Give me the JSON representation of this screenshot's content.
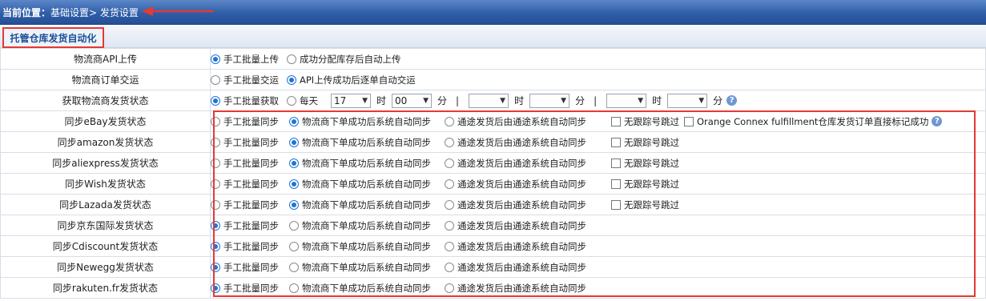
{
  "breadcrumb": {
    "label": "当前位置：",
    "path": "基础设置> 发货设置"
  },
  "section_title": "托管仓库发货自动化",
  "rows": [
    {
      "label": "物流商API上传",
      "options": [
        {
          "text": "手工批量上传",
          "checked": true
        },
        {
          "text": "成功分配库存后自动上传",
          "checked": false
        }
      ]
    },
    {
      "label": "物流商订单交运",
      "options": [
        {
          "text": "手工批量交运",
          "checked": false
        },
        {
          "text": "API上传成功后逐单自动交运",
          "checked": true
        }
      ]
    }
  ],
  "fetch_row": {
    "label": "获取物流商发货状态",
    "manual": "手工批量获取",
    "daily": "每天",
    "hour_value": "17",
    "min_value": "00",
    "hour_unit": "时",
    "min_unit": "分",
    "sep": "|"
  },
  "sync_options": [
    "手工批量同步",
    "物流商下单成功后系统自动同步",
    "通途发货后由通途系统自动同步"
  ],
  "skip_label": "无跟踪号跳过",
  "oc_label": "Orange Connex fulfillment仓库发货订单直接标记成功",
  "sync_rows": [
    {
      "label": "同步eBay发货状态",
      "selected": 1,
      "skip": true,
      "oc": true
    },
    {
      "label": "同步amazon发货状态",
      "selected": 1,
      "skip": true,
      "oc": false
    },
    {
      "label": "同步aliexpress发货状态",
      "selected": 1,
      "skip": true,
      "oc": false
    },
    {
      "label": "同步Wish发货状态",
      "selected": 1,
      "skip": true,
      "oc": false
    },
    {
      "label": "同步Lazada发货状态",
      "selected": 1,
      "skip": true,
      "oc": false
    },
    {
      "label": "同步京东国际发货状态",
      "selected": 0,
      "skip": false,
      "oc": false
    },
    {
      "label": "同步Cdiscount发货状态",
      "selected": 0,
      "skip": false,
      "oc": false
    },
    {
      "label": "同步Newegg发货状态",
      "selected": 0,
      "skip": false,
      "oc": false
    },
    {
      "label": "同步rakuten.fr发货状态",
      "selected": 0,
      "skip": false,
      "oc": false
    }
  ],
  "colors": {
    "topbar": "#2f5ea8",
    "highlight": "#e53935",
    "radio": "#1e74d6"
  }
}
